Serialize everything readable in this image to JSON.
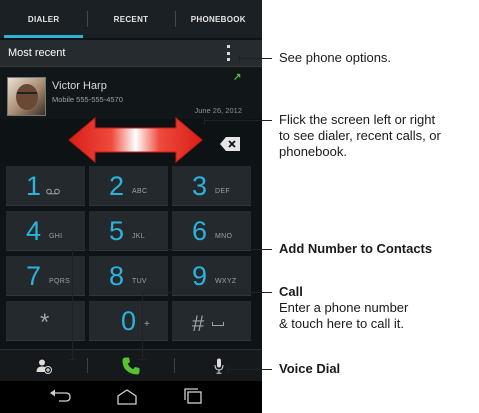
{
  "tabs": [
    {
      "label": "DIALER",
      "active": true
    },
    {
      "label": "RECENT",
      "active": false
    },
    {
      "label": "PHONEBOOK",
      "active": false
    }
  ],
  "header": {
    "title": "Most recent"
  },
  "recent_call": {
    "name": "Victor Harp",
    "number": "Mobile 555-555-4570",
    "date": "June 26, 2012"
  },
  "keypad": {
    "keys": [
      {
        "digit": "1",
        "letters": ""
      },
      {
        "digit": "2",
        "letters": "ABC"
      },
      {
        "digit": "3",
        "letters": "DEF"
      },
      {
        "digit": "4",
        "letters": "GHI"
      },
      {
        "digit": "5",
        "letters": "JKL"
      },
      {
        "digit": "6",
        "letters": "MNO"
      },
      {
        "digit": "7",
        "letters": "PQRS"
      },
      {
        "digit": "8",
        "letters": "TUV"
      },
      {
        "digit": "9",
        "letters": "WXYZ"
      },
      {
        "digit": "*",
        "letters": ""
      },
      {
        "digit": "0",
        "letters": "+"
      },
      {
        "digit": "#",
        "letters": ""
      }
    ]
  },
  "callouts": {
    "options": "See phone options.",
    "flick": [
      "Flick the screen left or right",
      "to see dialer, recent calls, or",
      "phonebook."
    ],
    "add_contact": "Add Number to Contacts",
    "call_title": "Call",
    "call_desc": [
      "Enter a phone number",
      "& touch here to call it."
    ],
    "voice": "Voice Dial"
  },
  "colors": {
    "accent": "#2fb3d5",
    "call_green": "#58c22f",
    "flick_red": "#e3251b"
  }
}
